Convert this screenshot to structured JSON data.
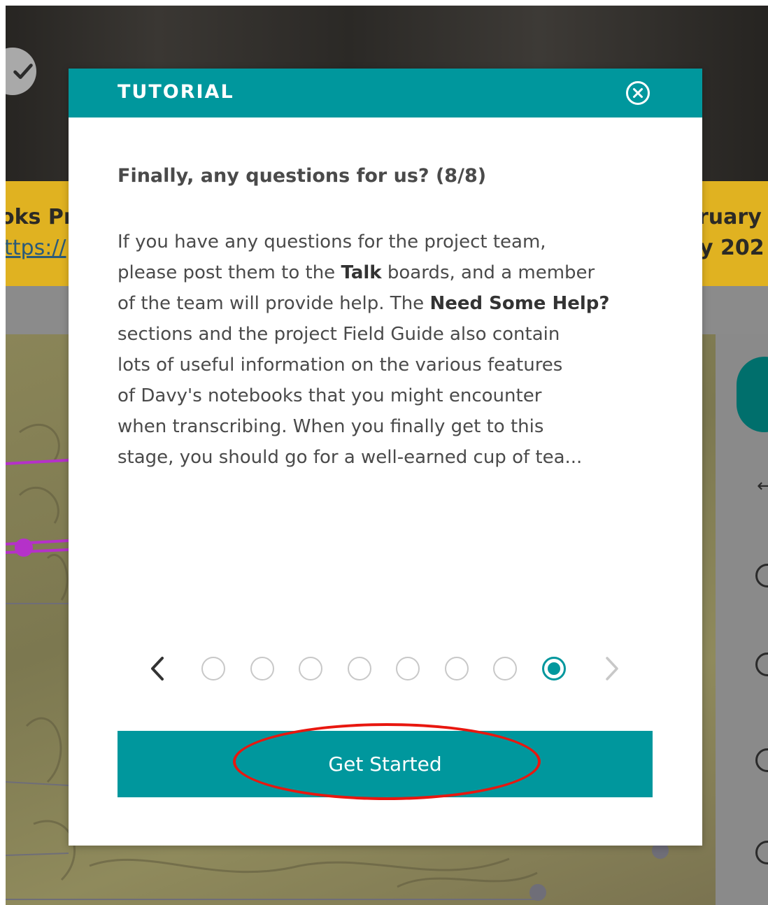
{
  "background": {
    "banner_left_line1": "oks Pr",
    "banner_left_line2": "ttps://",
    "banner_right_line1": "ruary",
    "banner_right_line2": "y 202"
  },
  "modal": {
    "title": "TUTORIAL",
    "heading": "Finally, any questions for us? (8/8)",
    "body": {
      "line1": "If you have any questions for the project team,",
      "line2_pre": "please post them to the ",
      "line2_bold": "Talk",
      "line2_post": " boards, and a member",
      "line3_pre": "of the team will provide help. The ",
      "line3_bold": "Need Some Help?",
      "line4": "sections and the project Field Guide also contain",
      "line5": "lots of useful information on the various features",
      "line6": "of Davy's notebooks that you might encounter",
      "line7": "when transcribing. When you finally get to this",
      "line8": "stage, you should go for a well-earned cup of tea..."
    },
    "pager": {
      "total": 8,
      "current": 8
    },
    "cta_label": "Get Started"
  },
  "colors": {
    "accent": "#00979d",
    "annotation": "#e8170f",
    "banner": "#e0b221"
  }
}
